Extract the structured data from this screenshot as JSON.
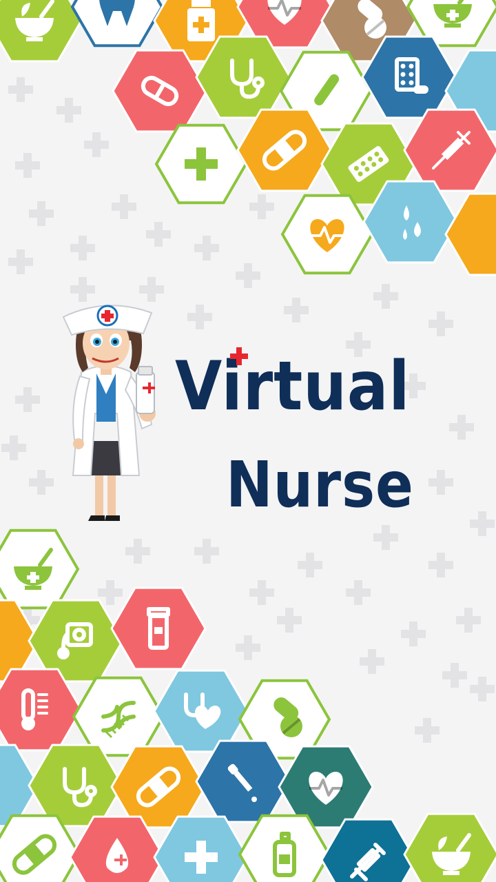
{
  "splash": {
    "title_line1": "Virtual",
    "title_line2": "Nurse"
  },
  "colors": {
    "background": "#f4f4f5",
    "title": "#0f2e58",
    "accent_red": "#e8262e",
    "green": "#8cc43c",
    "lime": "#a5cd3a",
    "orange": "#f6a91c",
    "coral": "#f2666b",
    "brown": "#b08b67",
    "sky": "#7fc8e0",
    "blue": "#2d74a8",
    "teal": "#2c7c74",
    "ocean": "#0e7196",
    "outline_green": "#8cc43c",
    "outline_blue": "#2d74a8"
  },
  "top_tiles": [
    {
      "name": "mortar-herbs-tile",
      "color": "lime",
      "icon": "mortar-herbs-icon"
    },
    {
      "name": "tooth-tile",
      "outline": "outline_blue",
      "icon": "tooth-icon"
    },
    {
      "name": "medicine-bottle-tile",
      "color": "orange",
      "icon": "medicine-bottle-icon"
    },
    {
      "name": "heart-rate-tile",
      "color": "coral",
      "icon": "heart-rate-icon"
    },
    {
      "name": "pills-tile",
      "color": "brown",
      "icon": "pills-icon"
    },
    {
      "name": "mortar-tile",
      "outline": "outline_green",
      "icon": "mortar-icon"
    },
    {
      "name": "capsule-tile",
      "color": "coral",
      "icon": "capsule-icon"
    },
    {
      "name": "stethoscope-tile",
      "color": "lime",
      "icon": "stethoscope-icon"
    },
    {
      "name": "test-tube-tile",
      "outline": "outline_green",
      "icon": "test-tube-icon"
    },
    {
      "name": "blister-pack-tile",
      "color": "blue",
      "icon": "blister-pack-icon"
    },
    {
      "name": "sky-tile-right",
      "color": "sky"
    },
    {
      "name": "cross-tile",
      "outline": "outline_green",
      "icon": "cross-icon"
    },
    {
      "name": "bandage-tile",
      "color": "orange",
      "icon": "bandage-icon"
    },
    {
      "name": "pill-strip-tile",
      "color": "lime",
      "icon": "pill-strip-icon"
    },
    {
      "name": "syringe-tile",
      "color": "coral",
      "icon": "syringe-icon"
    },
    {
      "name": "heart-monitor-tile",
      "outline": "outline_green",
      "icon": "heart-rate-icon"
    },
    {
      "name": "drops-tile",
      "color": "sky",
      "icon": "drops-icon"
    },
    {
      "name": "orange-edge-tile",
      "color": "orange"
    }
  ],
  "bottom_tiles": [
    {
      "name": "mortar-tile-bottom",
      "outline": "outline_green",
      "icon": "mortar-icon"
    },
    {
      "name": "orange-edge-tile-left",
      "color": "orange"
    },
    {
      "name": "blood-pressure-tile",
      "color": "lime",
      "icon": "blood-pressure-icon"
    },
    {
      "name": "pill-bottle-tile",
      "color": "coral",
      "icon": "pill-bottle-icon"
    },
    {
      "name": "thermometer-tile",
      "color": "coral",
      "icon": "thermometer-icon"
    },
    {
      "name": "dna-tile",
      "outline": "outline_green",
      "icon": "dna-icon"
    },
    {
      "name": "stethoscope-heart-tile",
      "color": "sky",
      "icon": "stethoscope-heart-icon"
    },
    {
      "name": "pills-outline-tile",
      "outline": "outline_green",
      "icon": "pills-icon"
    },
    {
      "name": "sky-edge-tile-left",
      "color": "sky"
    },
    {
      "name": "stethoscope-tile-bottom",
      "color": "lime",
      "icon": "stethoscope-icon"
    },
    {
      "name": "bandage-tile-bottom",
      "color": "orange",
      "icon": "bandage-icon"
    },
    {
      "name": "dropper-tile",
      "color": "blue",
      "icon": "dropper-icon"
    },
    {
      "name": "heart-rate-tile-bottom",
      "color": "teal",
      "icon": "heart-rate-icon"
    },
    {
      "name": "bandage-cross-tile",
      "outline": "outline_green",
      "icon": "bandage-icon"
    },
    {
      "name": "blood-drop-tile",
      "color": "coral",
      "icon": "drop-icon"
    },
    {
      "name": "cross-tile-bottom",
      "color": "sky",
      "icon": "cross-icon"
    },
    {
      "name": "lotion-bottle-tile",
      "outline": "outline_green",
      "icon": "lotion-bottle-icon"
    },
    {
      "name": "ampoule-tile",
      "color": "ocean",
      "icon": "ampoule-icon"
    },
    {
      "name": "mortar-herbs-tile-bottom",
      "color": "lime",
      "icon": "mortar-herbs-icon"
    }
  ]
}
